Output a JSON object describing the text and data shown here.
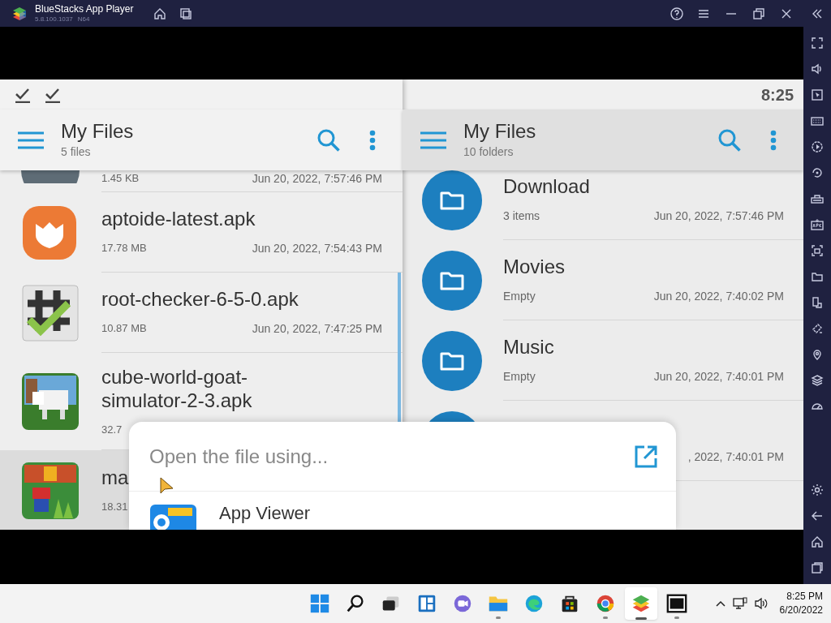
{
  "window": {
    "title": "BlueStacks App Player",
    "version": "5.8.100.1037",
    "build": "N64"
  },
  "left_pane": {
    "title": "My Files",
    "subtitle": "5 files",
    "files": [
      {
        "kind": "partial",
        "size": "1.45 KB",
        "date": "Jun 20, 2022, 7:57:46 PM",
        "selected": false
      },
      {
        "kind": "aptoide",
        "name": "aptoide-latest.apk",
        "size": "17.78 MB",
        "date": "Jun 20, 2022, 7:54:43 PM",
        "selected": false
      },
      {
        "kind": "rootcheck",
        "name": "root-checker-6-5-0.apk",
        "size": "10.87 MB",
        "date": "Jun 20, 2022, 7:47:25 PM",
        "selected": false
      },
      {
        "kind": "goat",
        "name": "cube-world-goat-simulator-2-3.apk",
        "size": "32.7",
        "selected": false
      },
      {
        "kind": "mario",
        "name": "ma",
        "size": "18.31",
        "selected": true
      }
    ]
  },
  "right_pane": {
    "clock": "8:25",
    "title": "My Files",
    "subtitle": "10 folders",
    "folders": [
      {
        "name": "Download",
        "meta": "3 items",
        "date": "Jun 20, 2022, 7:57:46 PM"
      },
      {
        "name": "Movies",
        "meta": "Empty",
        "date": "Jun 20, 2022, 7:40:02 PM"
      },
      {
        "name": "Music",
        "meta": "Empty",
        "date": "Jun 20, 2022, 7:40:01 PM"
      },
      {
        "date": ", 2022, 7:40:01 PM"
      }
    ]
  },
  "dialog": {
    "title": "Open the file using...",
    "apps": [
      {
        "name": "App Viewer"
      }
    ]
  },
  "taskbar": {
    "apps": [
      {
        "kind": "start",
        "running": false,
        "selected": false
      },
      {
        "kind": "search",
        "running": false,
        "selected": false
      },
      {
        "kind": "taskview",
        "running": false,
        "selected": false
      },
      {
        "kind": "widgets",
        "running": false,
        "selected": false
      },
      {
        "kind": "chat",
        "running": false,
        "selected": false
      },
      {
        "kind": "explorer",
        "running": true,
        "selected": false
      },
      {
        "kind": "edge",
        "running": false,
        "selected": false
      },
      {
        "kind": "store",
        "running": false,
        "selected": false
      },
      {
        "kind": "chrome",
        "running": true,
        "selected": false
      },
      {
        "kind": "bluestacks",
        "running": true,
        "selected": true
      },
      {
        "kind": "sevenzip",
        "running": true,
        "selected": false
      }
    ],
    "time": "8:25 PM",
    "date": "6/20/2022"
  }
}
